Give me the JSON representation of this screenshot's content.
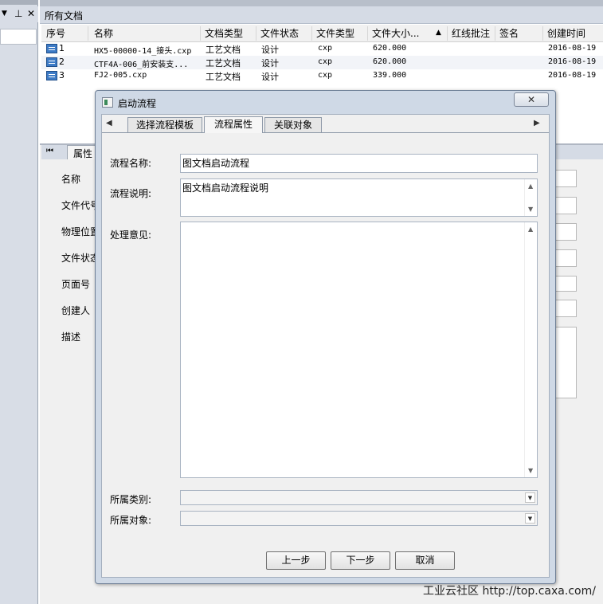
{
  "left_panel": {
    "controls": [
      "▼",
      "⊥",
      "✕"
    ]
  },
  "document_panel": {
    "title": "所有文档",
    "columns": [
      "序号",
      "名称",
      "文档类型",
      "文件状态",
      "文件类型",
      "文件大小...",
      "▲",
      "红线批注",
      "签名",
      "创建时间"
    ],
    "rows": [
      {
        "index": "1",
        "name": "HX5-00000-14_接头.cxp",
        "doc_type": "工艺文档",
        "status": "设计",
        "file_type": "cxp",
        "size": "620.000",
        "created": "2016-08-19"
      },
      {
        "index": "2",
        "name": "CTF4A-006_前安装支...",
        "doc_type": "工艺文档",
        "status": "设计",
        "file_type": "cxp",
        "size": "620.000",
        "created": "2016-08-19"
      },
      {
        "index": "3",
        "name": "FJ2-005.cxp",
        "doc_type": "工艺文档",
        "status": "设计",
        "file_type": "cxp",
        "size": "339.000",
        "created": "2016-08-19"
      }
    ]
  },
  "property_panel": {
    "tab_label": "属性",
    "labels": [
      "名称",
      "文件代号",
      "物理位置",
      "文件状态",
      "页面号",
      "创建人",
      "描述"
    ]
  },
  "dialog": {
    "title": "启动流程",
    "close_label": "✕",
    "tabs": [
      "选择流程模板",
      "流程属性",
      "关联对象"
    ],
    "form": {
      "name_label": "流程名称:",
      "name_value": "图文档启动流程",
      "desc_label": "流程说明:",
      "desc_value": "图文档启动流程说明",
      "opinion_label": "处理意见:",
      "opinion_value": "",
      "category_label": "所属类别:",
      "category_value": "",
      "object_label": "所属对象:",
      "object_value": ""
    },
    "buttons": {
      "prev": "上一步",
      "next": "下一步",
      "cancel": "取消"
    }
  },
  "watermark": "工业云社区 http://top.caxa.com/"
}
